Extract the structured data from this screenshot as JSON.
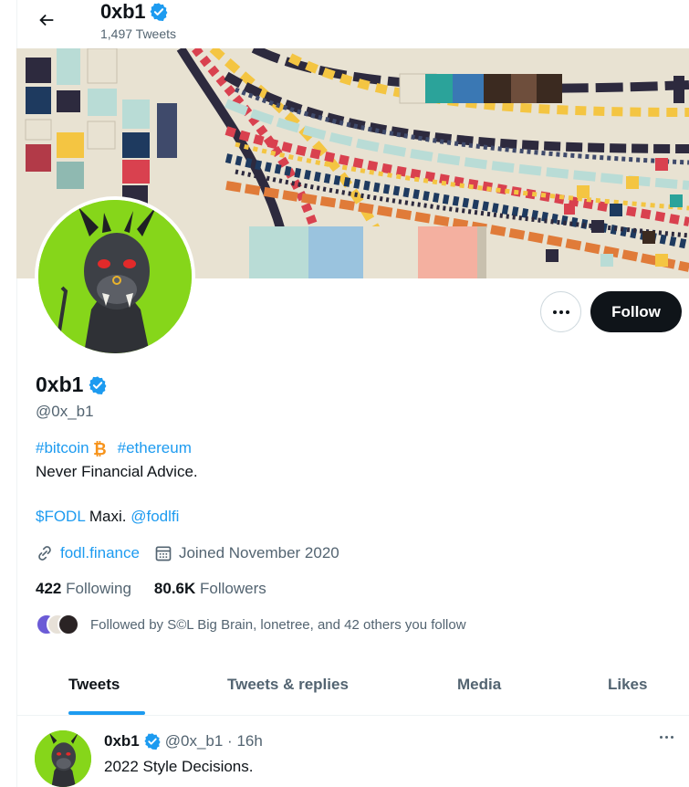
{
  "header": {
    "name": "0xb1",
    "tweet_count": "1,497 Tweets"
  },
  "profile": {
    "name": "0xb1",
    "handle": "@0x_b1",
    "bio_hashtag1": "#bitcoin",
    "bio_hashtag2": "#ethereum",
    "bio_line2": "Never Financial Advice.",
    "bio_cashtag": "$FODL",
    "bio_maxi": " Maxi. ",
    "bio_mention": "@fodlfi",
    "website": "fodl.finance",
    "joined": "Joined November 2020",
    "following_count": "422",
    "following_label": "Following",
    "followers_count": "80.6K",
    "followers_label": "Followers",
    "followed_by": "Followed by S©L Big Brain, lonetree, and 42 others you follow"
  },
  "actions": {
    "follow_label": "Follow"
  },
  "tabs": [
    {
      "label": "Tweets",
      "active": true
    },
    {
      "label": "Tweets & replies",
      "active": false
    },
    {
      "label": "Media",
      "active": false
    },
    {
      "label": "Likes",
      "active": false
    }
  ],
  "tweet": {
    "name": "0xb1",
    "handle": "@0x_b1",
    "separator": " · ",
    "time": "16h",
    "text": "2022 Style Decisions."
  },
  "colors": {
    "accent": "#1d9bf0",
    "text": "#0f1419",
    "muted": "#536471",
    "avatar_bg": "#86d61a",
    "bitcoin": "#f7931a"
  },
  "icons": {
    "back": "arrow-left-icon",
    "verified": "verified-badge-icon",
    "more": "more-dots-icon",
    "link": "link-icon",
    "calendar": "calendar-icon",
    "bitcoin": "bitcoin-icon"
  }
}
